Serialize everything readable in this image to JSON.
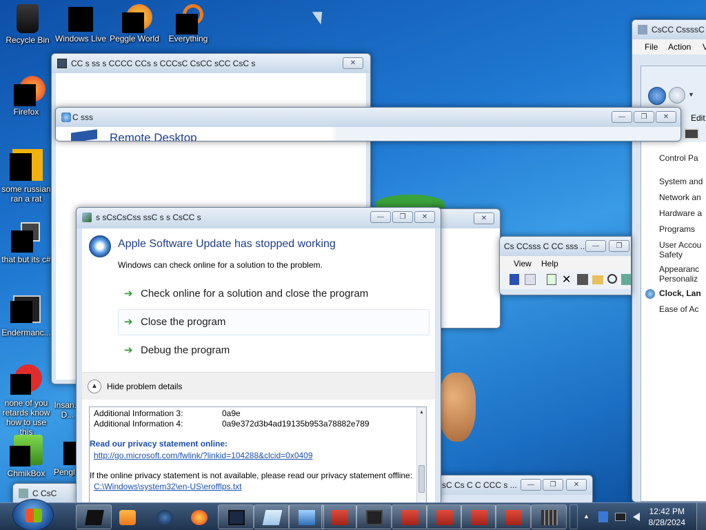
{
  "desktop": {
    "icons": [
      {
        "label": "Recycle Bin"
      },
      {
        "label": "Windows Live"
      },
      {
        "label": "Peggle World"
      },
      {
        "label": "Everything"
      },
      {
        "label": "Firefox"
      },
      {
        "label": "some russian ran a rat"
      },
      {
        "label": "that but its c#"
      },
      {
        "label": "Endermanc..."
      },
      {
        "label": "none of you retards know how to use this"
      },
      {
        "label": "ChmikBox"
      },
      {
        "label": "Insan... D..."
      },
      {
        "label": "Pengl..."
      }
    ]
  },
  "windows": {
    "back_window": {
      "title": "CC  s ss  s  CCCC CCs s CCCsC  CsCC  sCC CsC s"
    },
    "remote_desktop": {
      "title": "C sss",
      "heading": "Remote Desktop"
    },
    "control_panel": {
      "title": "CsCC CssssC",
      "menu": [
        "File",
        "Action",
        "V"
      ],
      "edit_label": "Edit",
      "items": [
        "Control Pa",
        "System and",
        "Network an",
        "Hardware a",
        "Programs",
        "User Accou Safety",
        "Appearanc Personaliz",
        "Clock, Lan",
        "Ease of Ac"
      ]
    },
    "mid_window": {
      "title": "Cs   CCsss C CC sss ...",
      "menu": [
        "View",
        "Help"
      ]
    },
    "bottom_window": {
      "title": "sC Cs C C  CCC  s ..."
    },
    "bottom_left_window": {
      "title": "C CsC"
    }
  },
  "dialog": {
    "title": "s sCsCsCss ssC s s CsCC s",
    "headline": "Apple Software Update has stopped working",
    "subline": "Windows can check online for a solution to the problem.",
    "options": [
      "Check online for a solution and close the program",
      "Close the program",
      "Debug the program"
    ],
    "hide_details": "Hide problem details",
    "details": {
      "row1_label": "Additional Information 3:",
      "row1_value": "0a9e",
      "row2_label": "Additional Information 4:",
      "row2_value": "0a9e372d3b4ad19135b953a78882e789",
      "privacy_heading": "Read our privacy statement online:",
      "privacy_link": "http://go.microsoft.com/fwlink/?linkid=104288&clcid=0x0409",
      "offline_text": "If the online privacy statement is not available, please read our privacy statement offline:",
      "offline_link": "C:\\Windows\\system32\\en-US\\erofflps.txt"
    }
  },
  "taskbar": {
    "time": "12:42 PM",
    "date": "8/28/2024",
    "tray_arrow": "▲"
  },
  "colors": {
    "accent_blue": "#1e3d8a",
    "link_blue": "#1a4fb0",
    "green_arrow": "#2e9a2e"
  }
}
